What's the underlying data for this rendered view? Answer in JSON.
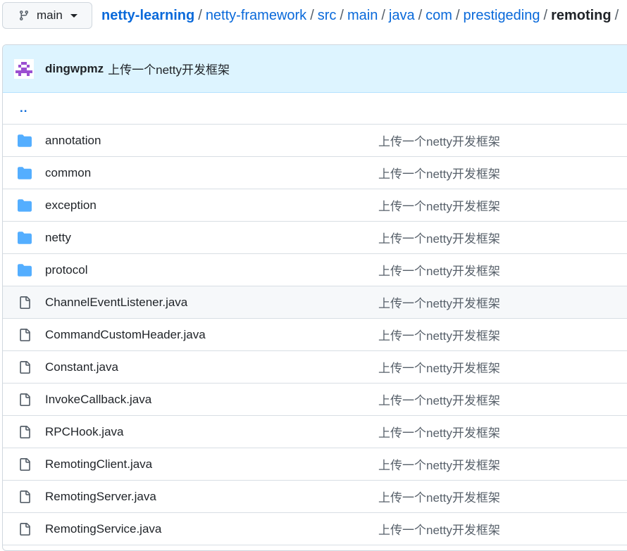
{
  "branch": {
    "label": "main",
    "icon": "git-branch-icon"
  },
  "breadcrumb": {
    "repo": "netty-learning",
    "path": [
      "netty-framework",
      "src",
      "main",
      "java",
      "com",
      "prestigeding"
    ],
    "current": "remoting",
    "separator": "/"
  },
  "commit": {
    "author": "dingwpmz",
    "message": "上传一个netty开发框架"
  },
  "parent_link": "..",
  "files": [
    {
      "type": "folder",
      "name": "annotation",
      "message": "上传一个netty开发框架"
    },
    {
      "type": "folder",
      "name": "common",
      "message": "上传一个netty开发框架"
    },
    {
      "type": "folder",
      "name": "exception",
      "message": "上传一个netty开发框架"
    },
    {
      "type": "folder",
      "name": "netty",
      "message": "上传一个netty开发框架"
    },
    {
      "type": "folder",
      "name": "protocol",
      "message": "上传一个netty开发框架"
    },
    {
      "type": "file",
      "name": "ChannelEventListener.java",
      "message": "上传一个netty开发框架"
    },
    {
      "type": "file",
      "name": "CommandCustomHeader.java",
      "message": "上传一个netty开发框架"
    },
    {
      "type": "file",
      "name": "Constant.java",
      "message": "上传一个netty开发框架"
    },
    {
      "type": "file",
      "name": "InvokeCallback.java",
      "message": "上传一个netty开发框架"
    },
    {
      "type": "file",
      "name": "RPCHook.java",
      "message": "上传一个netty开发框架"
    },
    {
      "type": "file",
      "name": "RemotingClient.java",
      "message": "上传一个netty开发框架"
    },
    {
      "type": "file",
      "name": "RemotingServer.java",
      "message": "上传一个netty开发框架"
    },
    {
      "type": "file",
      "name": "RemotingService.java",
      "message": "上传一个netty开发框架"
    }
  ],
  "colors": {
    "link": "#0969da",
    "folder": "#54aeff",
    "commit_bar": "#ddf4ff"
  }
}
